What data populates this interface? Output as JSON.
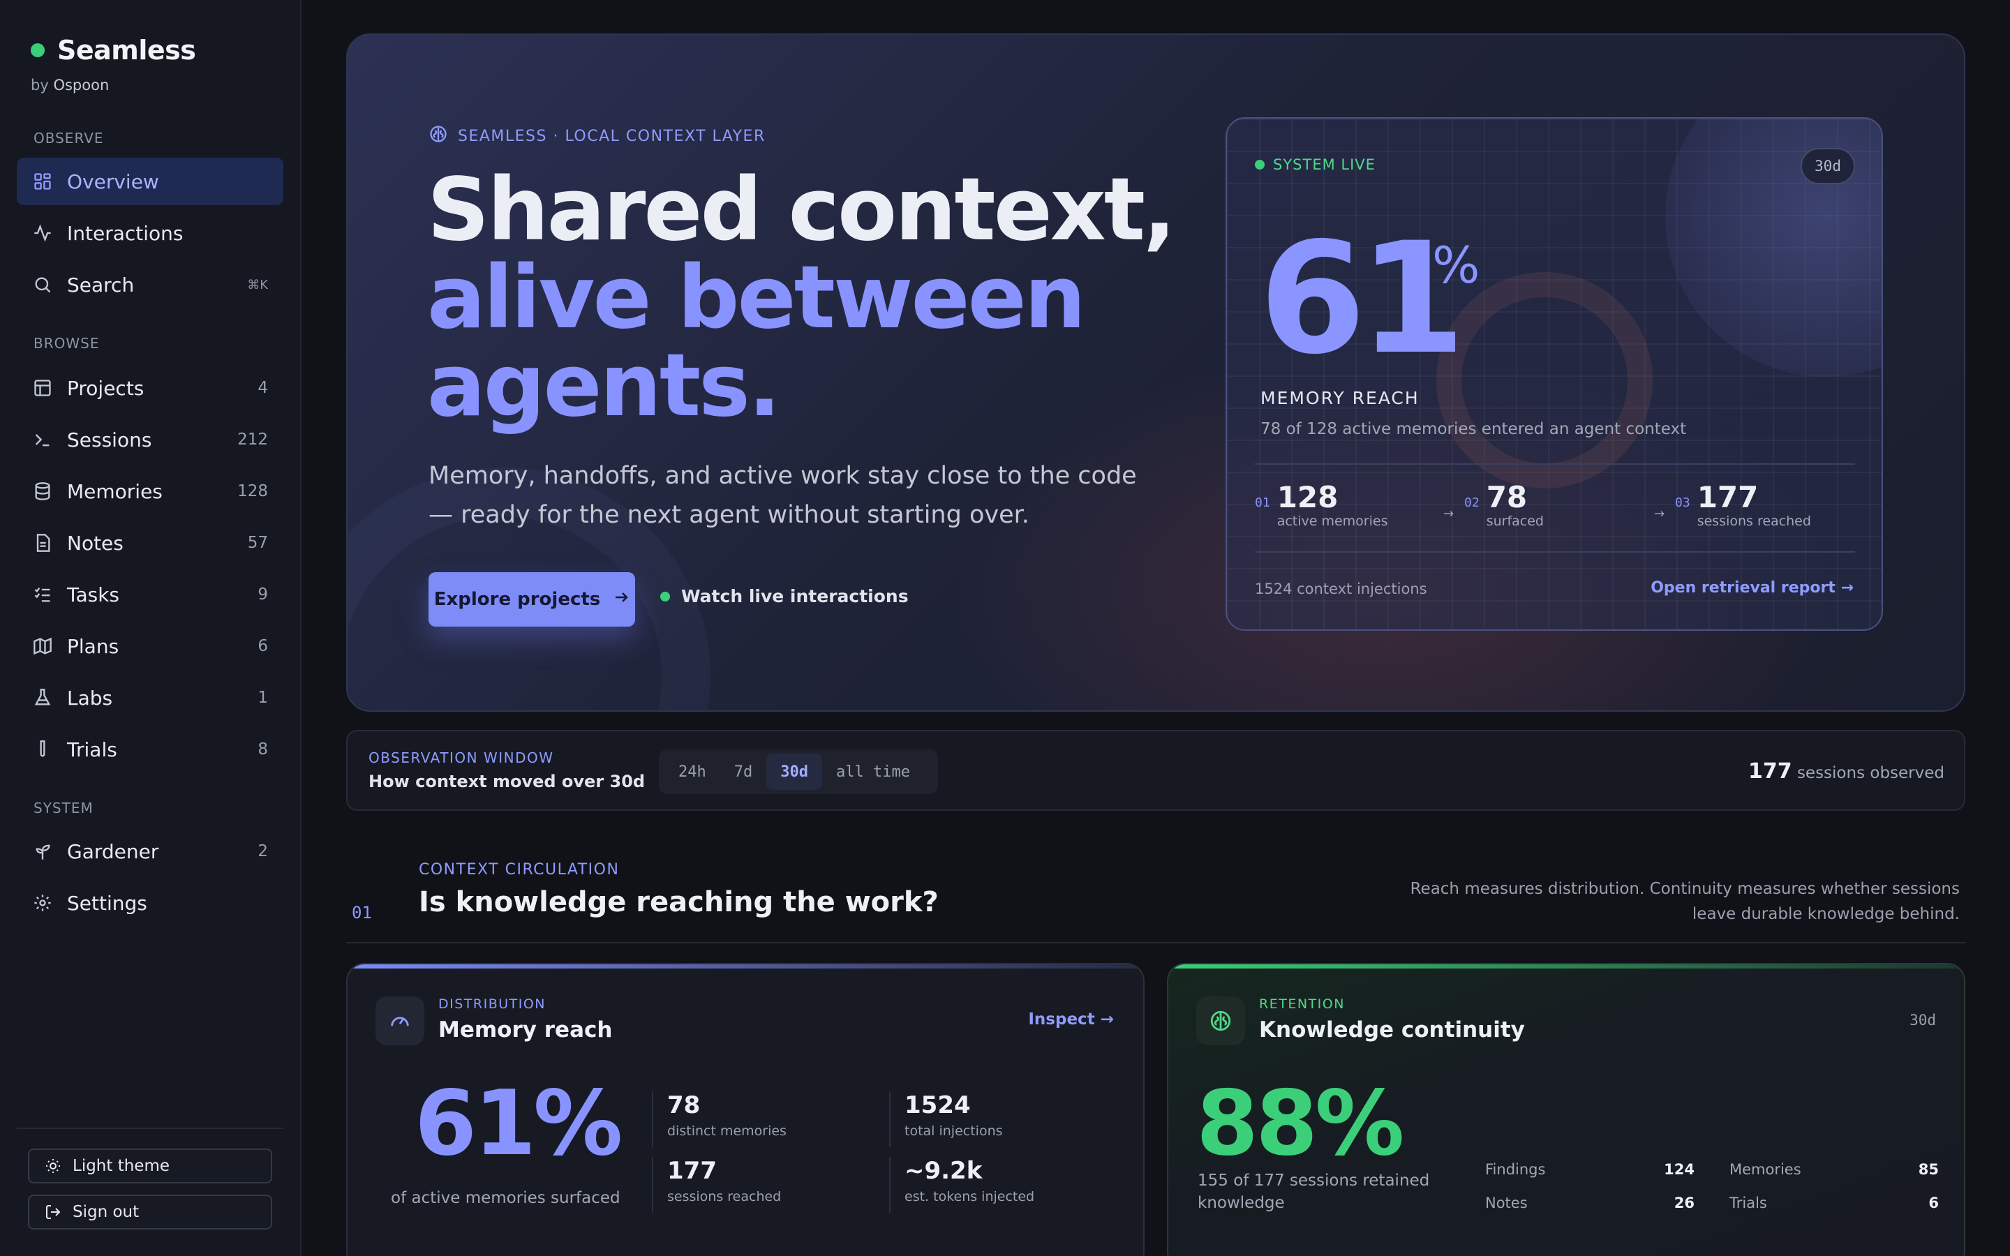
{
  "brand": {
    "name": "Seamless",
    "by_prefix": "by",
    "by_name": "Ospoon",
    "status_color": "#3ccf7a"
  },
  "nav": {
    "observe_label": "OBSERVE",
    "browse_label": "BROWSE",
    "system_label": "SYSTEM",
    "overview": "Overview",
    "interactions": "Interactions",
    "search": "Search",
    "search_shortcut": "⌘K",
    "projects": {
      "label": "Projects",
      "count": "4"
    },
    "sessions": {
      "label": "Sessions",
      "count": "212"
    },
    "memories": {
      "label": "Memories",
      "count": "128"
    },
    "notes": {
      "label": "Notes",
      "count": "57"
    },
    "tasks": {
      "label": "Tasks",
      "count": "9"
    },
    "plans": {
      "label": "Plans",
      "count": "6"
    },
    "labs": {
      "label": "Labs",
      "count": "1"
    },
    "trials": {
      "label": "Trials",
      "count": "8"
    },
    "gardener": {
      "label": "Gardener",
      "count": "2"
    },
    "settings": "Settings",
    "light_theme": "Light theme",
    "sign_out": "Sign out"
  },
  "hero": {
    "tag": "SEAMLESS · LOCAL CONTEXT LAYER",
    "title_line1": "Shared context,",
    "title_line2": "alive between",
    "title_line3": "agents.",
    "subtitle": "Memory, handoffs, and active work stay close to the code — ready for the next agent without starting over.",
    "primary_button": "Explore projects",
    "secondary_link": "Watch live interactions",
    "accent_color": "#8893ff"
  },
  "live_card": {
    "status": "SYSTEM LIVE",
    "range": "30d",
    "percent": "61",
    "percent_sign": "%",
    "metric_label": "MEMORY REACH",
    "metric_desc": "78 of 128 active memories entered an agent context",
    "stats": [
      {
        "idx": "01",
        "value": "128",
        "label": "active memories"
      },
      {
        "idx": "02",
        "value": "78",
        "label": "surfaced"
      },
      {
        "idx": "03",
        "value": "177",
        "label": "sessions reached"
      }
    ],
    "arrow": "→",
    "footer_left": "1524 context injections",
    "footer_right": "Open retrieval report"
  },
  "observation": {
    "kicker": "OBSERVATION WINDOW",
    "text": "How context moved over 30d",
    "ranges": [
      "24h",
      "7d",
      "30d",
      "all time"
    ],
    "active_range": "30d",
    "sessions_value": "177",
    "sessions_label": "sessions observed"
  },
  "section": {
    "number": "01",
    "kicker": "CONTEXT CIRCULATION",
    "title": "Is knowledge reaching the work?",
    "desc": "Reach measures distribution. Continuity measures whether sessions leave durable knowledge behind."
  },
  "reach_card": {
    "kicker": "DISTRIBUTION",
    "title": "Memory reach",
    "action": "Inspect",
    "big": "61%",
    "big_label": "of active memories surfaced",
    "stats": [
      {
        "value": "78",
        "label": "distinct memories"
      },
      {
        "value": "1524",
        "label": "total injections"
      },
      {
        "value": "177",
        "label": "sessions reached"
      },
      {
        "value": "~9.2k",
        "label": "est. tokens injected"
      }
    ],
    "color": "#8893ff"
  },
  "continuity_card": {
    "kicker": "RETENTION",
    "title": "Knowledge continuity",
    "badge": "30d",
    "big": "88%",
    "big_label": "155 of 177 sessions retained knowledge",
    "rows": [
      {
        "k": "Findings",
        "v": "124"
      },
      {
        "k": "Memories",
        "v": "85"
      },
      {
        "k": "Notes",
        "v": "26"
      },
      {
        "k": "Trials",
        "v": "6"
      }
    ],
    "color": "#3ccf7a"
  }
}
